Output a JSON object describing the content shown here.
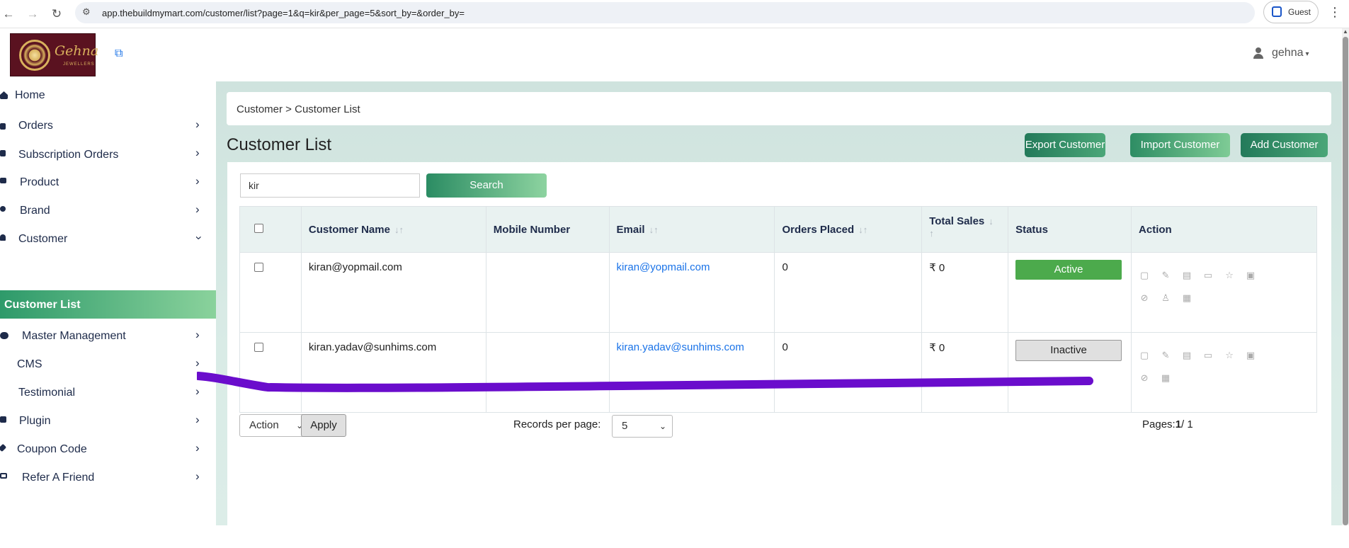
{
  "browser": {
    "url": "app.thebuildmymart.com/customer/list?page=1&q=kir&per_page=5&sort_by=&order_by=",
    "profile": "Guest"
  },
  "header": {
    "logo_text": "Gehna",
    "logo_sub": "JEWELLERS",
    "user_name": "gehna"
  },
  "sidebar": {
    "items": [
      {
        "label": "Home",
        "icon": "home-icon",
        "has_chevron": false
      },
      {
        "label": "Orders",
        "icon": "shopping-bag-icon",
        "has_chevron": true
      },
      {
        "label": "Subscription Orders",
        "icon": "shopping-bag-icon",
        "has_chevron": true
      },
      {
        "label": "Product",
        "icon": "product-icon",
        "has_chevron": true
      },
      {
        "label": "Brand",
        "icon": "share-icon",
        "has_chevron": true
      },
      {
        "label": "Customer",
        "icon": "user-icon",
        "has_chevron": true,
        "expanded": true
      },
      {
        "label": "Customer List",
        "active": true
      },
      {
        "label": "Master Management",
        "icon": "users-cog-icon",
        "has_chevron": true
      },
      {
        "label": "CMS",
        "icon": "",
        "has_chevron": true
      },
      {
        "label": "Testimonial",
        "icon": "",
        "has_chevron": true
      },
      {
        "label": "Plugin",
        "icon": "puzzle-icon",
        "has_chevron": true
      },
      {
        "label": "Coupon Code",
        "icon": "tag-icon",
        "has_chevron": true
      },
      {
        "label": "Refer A Friend",
        "icon": "keyboard-icon",
        "has_chevron": true
      }
    ]
  },
  "main": {
    "breadcrumb": "Customer > Customer List",
    "title": "Customer List",
    "buttons": {
      "export": "Export Customer",
      "import": "Import Customer",
      "add": "Add Customer"
    },
    "search": {
      "value": "kir",
      "button": "Search"
    },
    "table": {
      "columns": [
        "Customer Name",
        "Mobile Number",
        "Email",
        "Orders Placed",
        "Total Sales",
        "Status",
        "Action"
      ],
      "rows": [
        {
          "name": "kiran@yopmail.com",
          "mobile": "",
          "email": "kiran@yopmail.com",
          "orders": "0",
          "sales": "₹ 0",
          "status": "Active"
        },
        {
          "name": "kiran.yadav@sunhims.com",
          "mobile": "",
          "email": "kiran.yadav@sunhims.com",
          "orders": "0",
          "sales": "₹ 0",
          "status": "Inactive"
        }
      ]
    },
    "footer": {
      "bulk_action": "Action",
      "apply": "Apply",
      "records_label": "Records per page:",
      "per_page": "5",
      "pages_label": "Pages:",
      "current_page": "1",
      "total_pages": "/ 1"
    }
  },
  "colors": {
    "accent_green": "#2e9a6a",
    "active_status": "#4caa4c",
    "scribble": "#6a0dcc"
  }
}
